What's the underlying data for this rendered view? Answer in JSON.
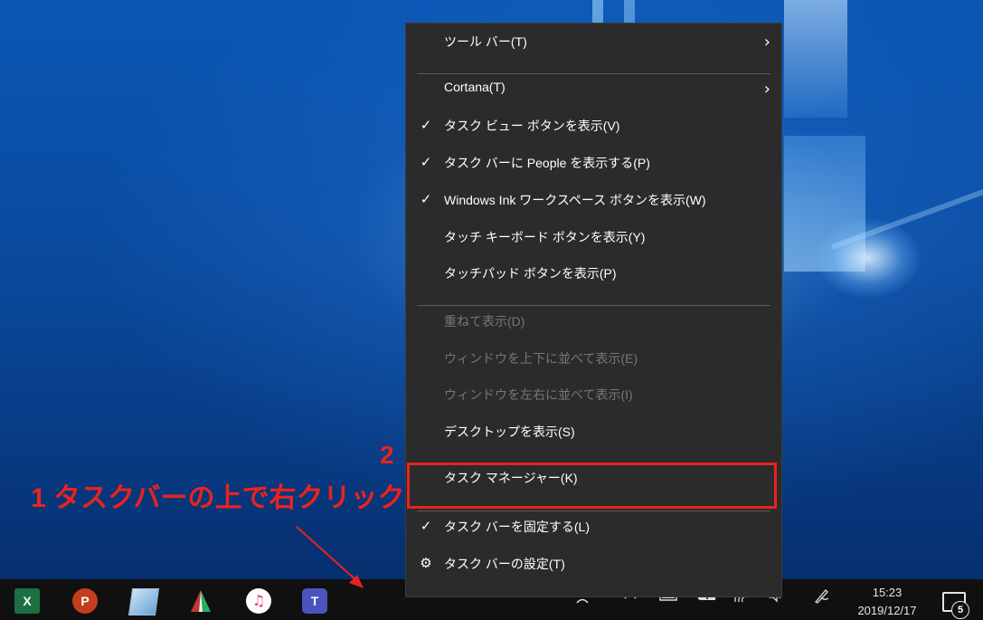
{
  "menu": {
    "items": [
      {
        "label": "ツール バー(T)",
        "check": "",
        "arrow": "›"
      },
      {
        "label": "Cortana(T)",
        "check": "",
        "arrow": "›"
      },
      {
        "label": "タスク ビュー ボタンを表示(V)",
        "check": "✓",
        "arrow": ""
      },
      {
        "label": "タスク バーに People を表示する(P)",
        "check": "✓",
        "arrow": ""
      },
      {
        "label": "Windows Ink ワークスペース ボタンを表示(W)",
        "check": "✓",
        "arrow": ""
      },
      {
        "label": "タッチ キーボード ボタンを表示(Y)",
        "check": "",
        "arrow": ""
      },
      {
        "label": "タッチパッド ボタンを表示(P)",
        "check": "",
        "arrow": ""
      },
      {
        "label": "重ねて表示(D)",
        "check": "",
        "arrow": ""
      },
      {
        "label": "ウィンドウを上下に並べて表示(E)",
        "check": "",
        "arrow": ""
      },
      {
        "label": "ウィンドウを左右に並べて表示(I)",
        "check": "",
        "arrow": ""
      },
      {
        "label": "デスクトップを表示(S)",
        "check": "",
        "arrow": ""
      },
      {
        "label": "タスク マネージャー(K)",
        "check": "",
        "arrow": ""
      },
      {
        "label": "タスク バーを固定する(L)",
        "check": "✓",
        "arrow": ""
      },
      {
        "label": "タスク バーの設定(T)",
        "check": "⚙",
        "arrow": ""
      }
    ]
  },
  "annotations": {
    "step1": "1 タスクバーの上で右クリック",
    "step2": "2",
    "color": "#e8231f"
  },
  "taskbar": {
    "apps": [
      {
        "name": "excel-icon",
        "glyph": "X"
      },
      {
        "name": "powerpoint-icon",
        "glyph": "P"
      },
      {
        "name": "notepad-icon",
        "glyph": ""
      },
      {
        "name": "snipping-tool-icon",
        "glyph": ""
      },
      {
        "name": "itunes-icon",
        "glyph": "♫"
      },
      {
        "name": "teams-icon",
        "glyph": "T"
      }
    ],
    "clock_time": "15:23",
    "clock_date": "2019/12/17",
    "notification_count": "5"
  },
  "colors": {
    "menu_bg": "#2b2b2b",
    "taskbar_bg": "#101010",
    "highlight": "#e8231f",
    "disabled_text": "#777777"
  }
}
